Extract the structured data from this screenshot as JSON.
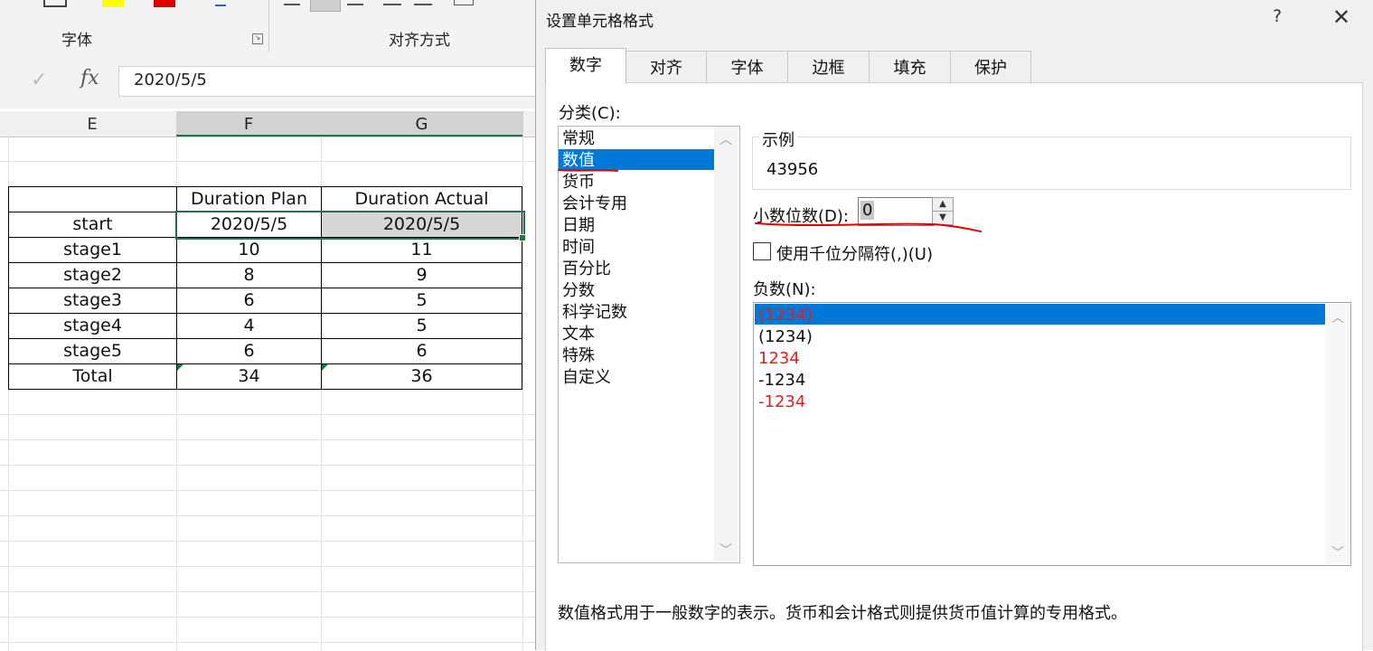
{
  "ribbon": {
    "groups": [
      {
        "label": "字体"
      },
      {
        "label": "对齐方式"
      }
    ]
  },
  "formula_bar": {
    "value": "2020/5/5"
  },
  "sheet": {
    "columns": [
      "E",
      "F",
      "G"
    ],
    "headers": [
      "",
      "Duration Plan",
      "Duration Actual"
    ],
    "rows": [
      [
        "start",
        "2020/5/5",
        "2020/5/5"
      ],
      [
        "stage1",
        "10",
        "11"
      ],
      [
        "stage2",
        "8",
        "9"
      ],
      [
        "stage3",
        "6",
        "5"
      ],
      [
        "stage4",
        "4",
        "5"
      ],
      [
        "stage5",
        "6",
        "6"
      ],
      [
        "Total",
        "34",
        "36"
      ]
    ]
  },
  "dialog": {
    "title": "设置单元格格式",
    "help": "?",
    "close": "✕",
    "tabs": [
      "数字",
      "对齐",
      "字体",
      "边框",
      "填充",
      "保护"
    ],
    "active_tab": "数字",
    "category_label": "分类(C):",
    "categories": [
      "常规",
      "数值",
      "货币",
      "会计专用",
      "日期",
      "时间",
      "百分比",
      "分数",
      "科学记数",
      "文本",
      "特殊",
      "自定义"
    ],
    "selected_category": "数值",
    "sample_label": "示例",
    "sample_value": "43956",
    "decimal_label": "小数位数(D):",
    "decimal_value": "0",
    "thousands_label": "使用千位分隔符(,)(U)",
    "thousands_checked": false,
    "negative_label": "负数(N):",
    "negative_options": [
      {
        "text": "(1234)",
        "color": "#e02020",
        "selected": true
      },
      {
        "text": "(1234)",
        "color": "#111111",
        "selected": false
      },
      {
        "text": "1234",
        "color": "#e02020",
        "selected": false
      },
      {
        "text": "-1234",
        "color": "#111111",
        "selected": false
      },
      {
        "text": "-1234",
        "color": "#e02020",
        "selected": false
      }
    ],
    "description": "数值格式用于一般数字的表示。货币和会计格式则提供货币值计算的专用格式。"
  },
  "colors": {
    "excel_green": "#217346",
    "selection_blue": "#0078d7",
    "annotation_red": "#e00000"
  }
}
